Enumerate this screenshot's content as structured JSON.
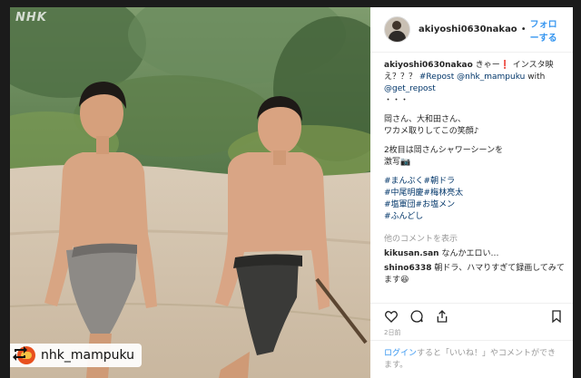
{
  "watermark": "NHK",
  "repost_badge": {
    "username": "nhk_mampuku",
    "icon": "repost-icon"
  },
  "post": {
    "author": "akiyoshi0630nakao",
    "separator": "•",
    "follow_label": "フォローする",
    "caption": {
      "user": "akiyoshi0630nakao",
      "line1": "きゃー❗ インスタ映え？？？",
      "repost_tag": "#Repost",
      "mention1": "@nhk_mampuku",
      "with_word": "with",
      "mention2": "@get_repost",
      "dots": "・・・",
      "line2": "岡さん、大和田さん、",
      "line3": "ワカメ取りしてこの笑顔♪",
      "line4": "2枚目は岡さんシャワーシーンを",
      "line5": "激写📷",
      "hashtags": [
        "#まんぷく",
        "#朝ドラ",
        "#中尾明慶",
        "#梅林亮太",
        "#塩軍団",
        "#お塩メン",
        "#ふんどし"
      ]
    },
    "view_comments_label": "他のコメントを表示",
    "comments": [
      {
        "user": "kikusan.san",
        "text": "なんかエロい…"
      },
      {
        "user": "shino6338",
        "text": "朝ドラ、ハマりすぎて録画してみてます😆"
      }
    ],
    "timestamp": "2日前",
    "login_prompt": {
      "link": "ログイン",
      "text": "すると「いいね！」やコメントができます。"
    },
    "icons": [
      "heart-icon",
      "comment-icon",
      "share-icon",
      "bookmark-icon"
    ]
  }
}
